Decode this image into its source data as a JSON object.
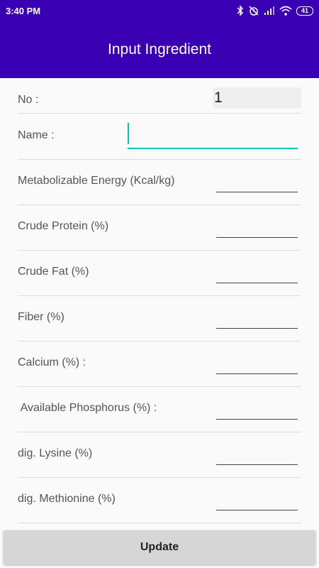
{
  "status_bar": {
    "time": "3:40 PM",
    "battery": "41",
    "icons": [
      "bluetooth-icon",
      "alarm-off-icon",
      "signal-icon",
      "wifi-icon",
      "battery-icon"
    ]
  },
  "app_bar": {
    "title": "Input Ingredient",
    "color": "#3a00b4"
  },
  "form": {
    "no": {
      "label": "No :",
      "value": "1"
    },
    "name": {
      "label": "Name :",
      "value": ""
    },
    "fields": [
      {
        "label": "Metabolizable Energy (Kcal/kg)",
        "value": ""
      },
      {
        "label": "Crude Protein (%)",
        "value": ""
      },
      {
        "label": "Crude Fat (%)",
        "value": ""
      },
      {
        "label": "Fiber (%)",
        "value": ""
      },
      {
        "label": "Calcium (%) :",
        "value": ""
      },
      {
        "label": " Available Phosphorus (%) :",
        "value": ""
      },
      {
        "label": "dig. Lysine (%)",
        "value": ""
      },
      {
        "label": "dig. Methionine (%)",
        "value": ""
      }
    ]
  },
  "update_button": {
    "label": "Update"
  },
  "colors": {
    "accent": "#00c9b0",
    "primary": "#3a00b4"
  }
}
